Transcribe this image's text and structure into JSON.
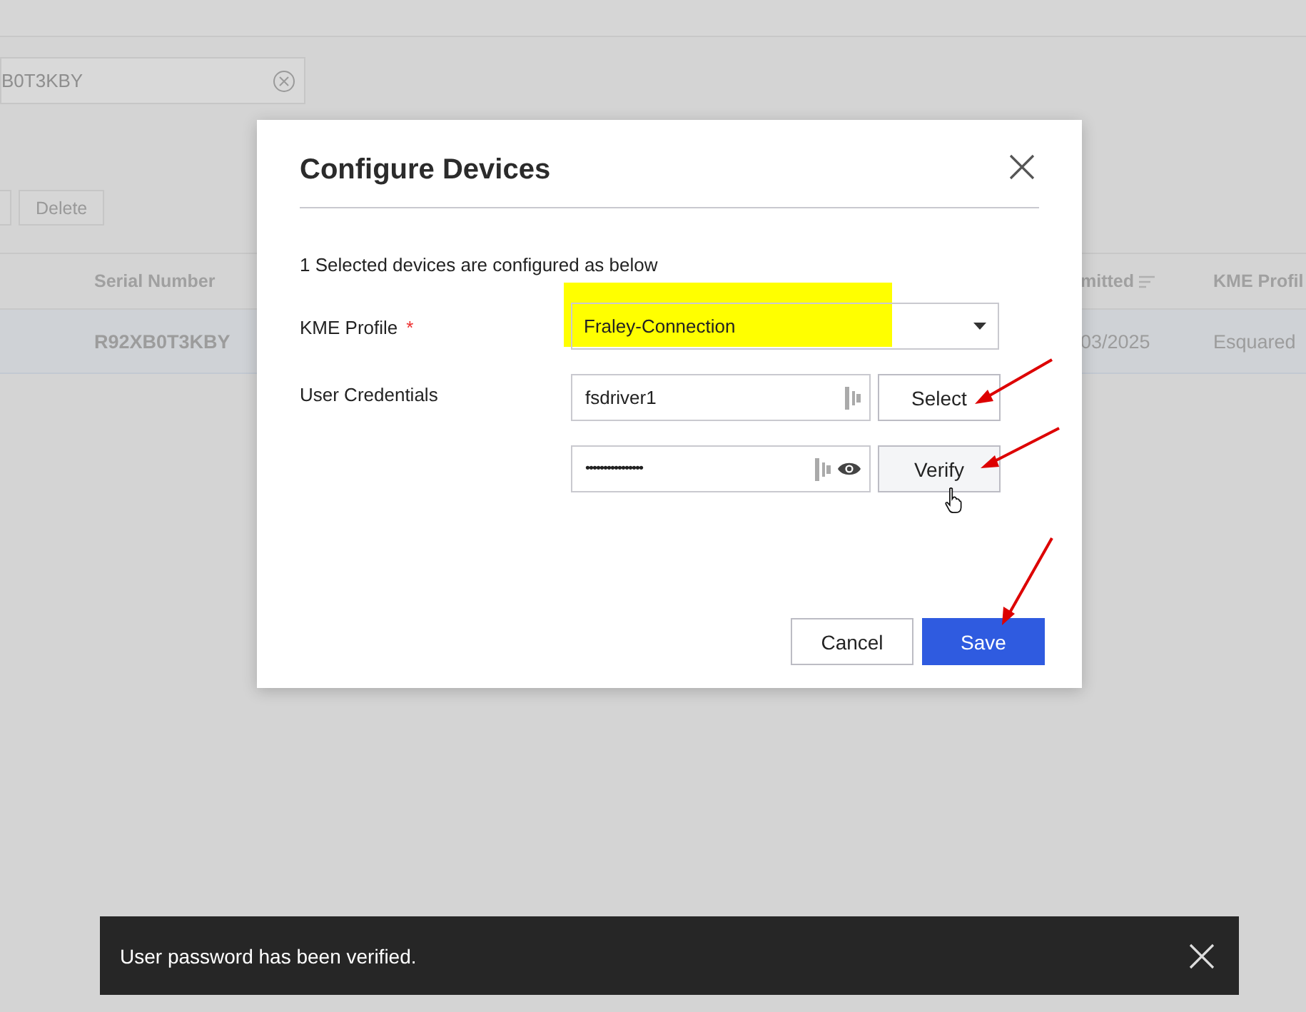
{
  "page": {
    "search": {
      "value": "B0T3KBY"
    },
    "toolbar_buttons": [
      {
        "label": "Delete"
      }
    ],
    "table": {
      "columns": [
        {
          "label": "Serial Number",
          "sortable": false
        },
        {
          "label": "mitted",
          "sortable": true
        },
        {
          "label": "KME Profil",
          "sortable": false
        }
      ],
      "rows": [
        {
          "cells": [
            "R92XB0T3KBY",
            "03/2025",
            "Esquared"
          ],
          "selected": true
        }
      ]
    }
  },
  "dialog": {
    "title": "Configure Devices",
    "subtitle": "1 Selected devices are configured as below",
    "profile": {
      "label": "KME Profile",
      "required_mark": "*",
      "value": "Fraley-Connection",
      "highlighted": true
    },
    "credentials": {
      "label": "User Credentials",
      "username": "fsdriver1",
      "password": "••••••••••••••••",
      "select_button": "Select",
      "verify_button": {
        "label": "Verify",
        "hovered": true
      }
    },
    "buttons": [
      {
        "label": "Cancel",
        "kind": "secondary"
      },
      {
        "label": "Save",
        "kind": "primary"
      }
    ]
  },
  "toast": {
    "message": "User password has been verified."
  }
}
